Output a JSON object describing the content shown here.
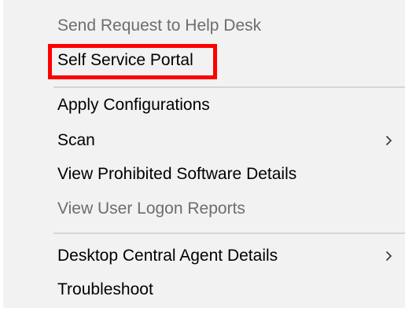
{
  "menu": {
    "items": [
      {
        "label": "Send Request to Help Desk",
        "disabled": true,
        "submenu": false
      },
      {
        "label": "Self Service Portal",
        "disabled": false,
        "submenu": false
      },
      {
        "label": "Apply Configurations",
        "disabled": false,
        "submenu": false
      },
      {
        "label": "Scan",
        "disabled": false,
        "submenu": true
      },
      {
        "label": "View Prohibited Software Details",
        "disabled": false,
        "submenu": false
      },
      {
        "label": "View User Logon Reports",
        "disabled": true,
        "submenu": false
      },
      {
        "label": "Desktop Central Agent Details",
        "disabled": false,
        "submenu": true
      },
      {
        "label": "Troubleshoot",
        "disabled": false,
        "submenu": false
      }
    ],
    "submenu_icon": "chevron-right-icon",
    "highlighted_item": "Self Service Portal",
    "highlight_color": "#ff0000",
    "disabled_text_color": "#6d6d6d",
    "background_color": "#f2f2f2"
  }
}
